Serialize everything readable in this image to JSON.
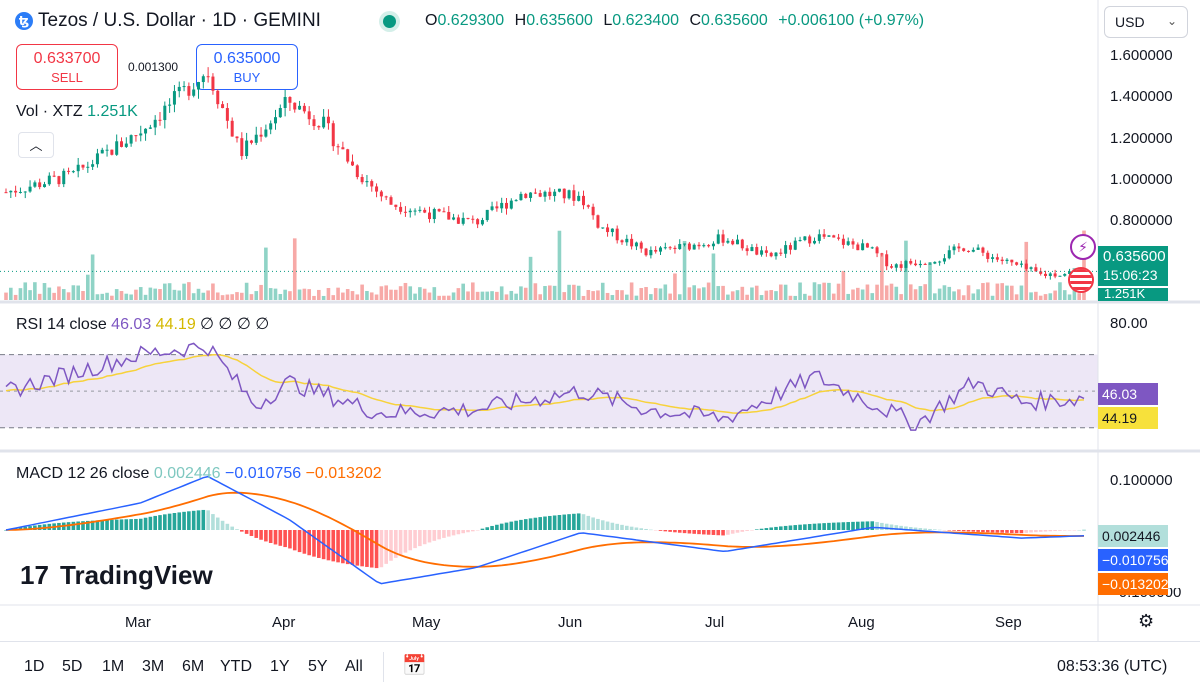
{
  "header": {
    "symbol_title": "Tezos / U.S. Dollar · 1D · GEMINI",
    "coin_icon": "tezos-icon",
    "ohlc": [
      {
        "k": "O",
        "v": "0.629300"
      },
      {
        "k": "H",
        "v": "0.635600"
      },
      {
        "k": "L",
        "v": "0.623400"
      },
      {
        "k": "C",
        "v": "0.635600"
      }
    ],
    "change": "+0.006100 (+0.97%)",
    "currency": "USD"
  },
  "trade": {
    "sell_price": "0.633700",
    "sell_label": "SELL",
    "buy_price": "0.635000",
    "buy_label": "BUY",
    "spread": "0.001300"
  },
  "volume": {
    "label": "Vol · XTZ",
    "value": "1.251K"
  },
  "rsi": {
    "label": "RSI 14 close",
    "value": "46.03",
    "ma_value": "44.19",
    "extra": "∅ ∅ ∅ ∅",
    "axis_tick": "80.00"
  },
  "macd": {
    "label": "MACD 12 26 close",
    "hist": "0.002446",
    "macd_val": "−0.010756",
    "signal_val": "−0.013202",
    "axis_top": "0.100000",
    "axis_bottom": "−0.100000"
  },
  "price_axis": {
    "ticks": [
      "1.600000",
      "1.400000",
      "1.200000",
      "1.000000",
      "0.800000"
    ],
    "last_price": "0.635600",
    "countdown": "15:06:23",
    "vol_tag": "1.251K"
  },
  "time_axis": [
    "Mar",
    "Apr",
    "May",
    "Jun",
    "Jul",
    "Aug",
    "Sep"
  ],
  "ranges": [
    "1D",
    "5D",
    "1M",
    "3M",
    "6M",
    "YTD",
    "1Y",
    "5Y",
    "All"
  ],
  "clock": "08:53:36 (UTC)",
  "logo": "TradingView",
  "colors": {
    "up": "#089981",
    "down": "#f23645",
    "rsi": "#7e57c2",
    "rsi_ma": "#f7d23b",
    "macd": "#2962ff",
    "signal": "#ff6d00",
    "rsi_band": "#ede7f6"
  },
  "chart_data": [
    {
      "type": "candlestick",
      "title": "Tezos / U.S. Dollar · 1D · GEMINI",
      "ylim": [
        0.55,
        1.7
      ],
      "x": [
        "2023-02-01",
        "2023-02-15",
        "2023-03-01",
        "2023-03-08",
        "2023-03-15",
        "2023-03-22",
        "2023-04-01",
        "2023-04-08",
        "2023-04-15",
        "2023-04-22",
        "2023-05-01",
        "2023-05-10",
        "2023-05-20",
        "2023-06-01",
        "2023-06-05",
        "2023-06-15",
        "2023-06-25",
        "2023-07-01",
        "2023-07-10",
        "2023-07-20",
        "2023-07-31",
        "2023-08-05",
        "2023-08-15",
        "2023-08-20",
        "2023-08-31",
        "2023-09-05",
        "2023-09-14"
      ],
      "close": [
        1.0,
        1.08,
        1.28,
        1.42,
        1.56,
        1.18,
        1.42,
        1.32,
        1.1,
        0.95,
        0.9,
        0.86,
        1.0,
        0.98,
        0.84,
        0.72,
        0.76,
        0.79,
        0.7,
        0.8,
        0.74,
        0.66,
        0.7,
        0.75,
        0.66,
        0.62,
        0.6356
      ]
    },
    {
      "type": "line",
      "name": "RSI 14 close",
      "ylim": [
        20,
        90
      ],
      "x": [
        "2023-02-01",
        "2023-03-01",
        "2023-03-15",
        "2023-03-25",
        "2023-04-01",
        "2023-04-20",
        "2023-05-10",
        "2023-06-01",
        "2023-06-15",
        "2023-07-01",
        "2023-07-20",
        "2023-08-10",
        "2023-08-22",
        "2023-09-01",
        "2023-09-14"
      ],
      "y": [
        50,
        70,
        75,
        42,
        55,
        38,
        40,
        50,
        40,
        35,
        58,
        32,
        55,
        44,
        46.03
      ]
    },
    {
      "type": "line",
      "name": "MACD 12 26 close",
      "ylim": [
        -0.13,
        0.13
      ],
      "x": [
        "2023-02-01",
        "2023-03-01",
        "2023-03-15",
        "2023-04-01",
        "2023-04-20",
        "2023-05-10",
        "2023-06-01",
        "2023-07-01",
        "2023-08-01",
        "2023-09-01",
        "2023-09-14"
      ],
      "y": [
        0.0,
        0.05,
        0.1,
        0.02,
        -0.1,
        -0.07,
        -0.005,
        -0.04,
        0.005,
        -0.015,
        -0.010756
      ]
    }
  ]
}
